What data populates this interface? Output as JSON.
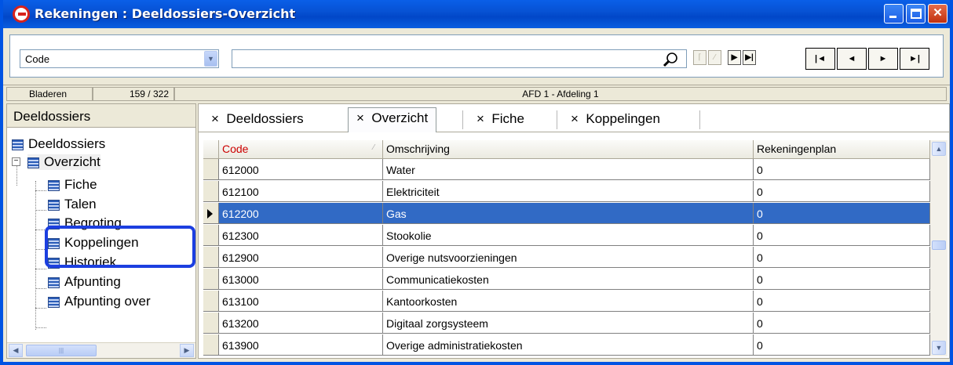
{
  "window": {
    "title": "Rekeningen : Deeldossiers-Overzicht"
  },
  "toolbar": {
    "field_select": "Code",
    "search_value": "",
    "nav": {
      "first": "◄",
      "prev": "◄",
      "next": "►",
      "last": "►"
    }
  },
  "statusbar": {
    "mode": "Bladeren",
    "position": "159 / 322",
    "department": "AFD 1 - Afdeling 1"
  },
  "sidebar": {
    "header": "Deeldossiers",
    "tree": [
      {
        "label": "Deeldossiers",
        "level": 0
      },
      {
        "label": "Overzicht",
        "level": 1,
        "expanded": true
      },
      {
        "label": "Fiche",
        "level": 2
      },
      {
        "label": "Talen",
        "level": 2
      },
      {
        "label": "Begroting",
        "level": 2
      },
      {
        "label": "Koppelingen",
        "level": 2,
        "highlighted": true
      },
      {
        "label": "Historiek",
        "level": 2
      },
      {
        "label": "Afpunting",
        "level": 2
      },
      {
        "label": "Afpunting over",
        "level": 2
      }
    ]
  },
  "tabs": [
    {
      "label": "Deeldossiers",
      "active": false
    },
    {
      "label": "Overzicht",
      "active": true
    },
    {
      "label": "Fiche",
      "active": false
    },
    {
      "label": "Koppelingen",
      "active": false
    }
  ],
  "tab_close_glyph": "×",
  "grid": {
    "columns": [
      "Code",
      "Omschrijving",
      "Rekeningenplan"
    ],
    "sort_column": "Code",
    "rows": [
      {
        "code": "612000",
        "omschrijving": "Water",
        "rekeningenplan": "0",
        "selected": false
      },
      {
        "code": "612100",
        "omschrijving": "Elektriciteit",
        "rekeningenplan": "0",
        "selected": false
      },
      {
        "code": "612200",
        "omschrijving": "Gas",
        "rekeningenplan": "0",
        "selected": true
      },
      {
        "code": "612300",
        "omschrijving": "Stookolie",
        "rekeningenplan": "0",
        "selected": false
      },
      {
        "code": "612900",
        "omschrijving": "Overige nutsvoorzieningen",
        "rekeningenplan": "0",
        "selected": false
      },
      {
        "code": "613000",
        "omschrijving": "Communicatiekosten",
        "rekeningenplan": "0",
        "selected": false
      },
      {
        "code": "613100",
        "omschrijving": "Kantoorkosten",
        "rekeningenplan": "0",
        "selected": false
      },
      {
        "code": "613200",
        "omschrijving": "Digitaal zorgsysteem",
        "rekeningenplan": "0",
        "selected": false
      },
      {
        "code": "613900",
        "omschrijving": "Overige administratiekosten",
        "rekeningenplan": "0",
        "selected": false
      }
    ]
  },
  "colors": {
    "title_bar": "#0752d4",
    "selection": "#316ac5",
    "sort_header_text": "#cc0000",
    "highlight_box": "#1c3fe0"
  }
}
